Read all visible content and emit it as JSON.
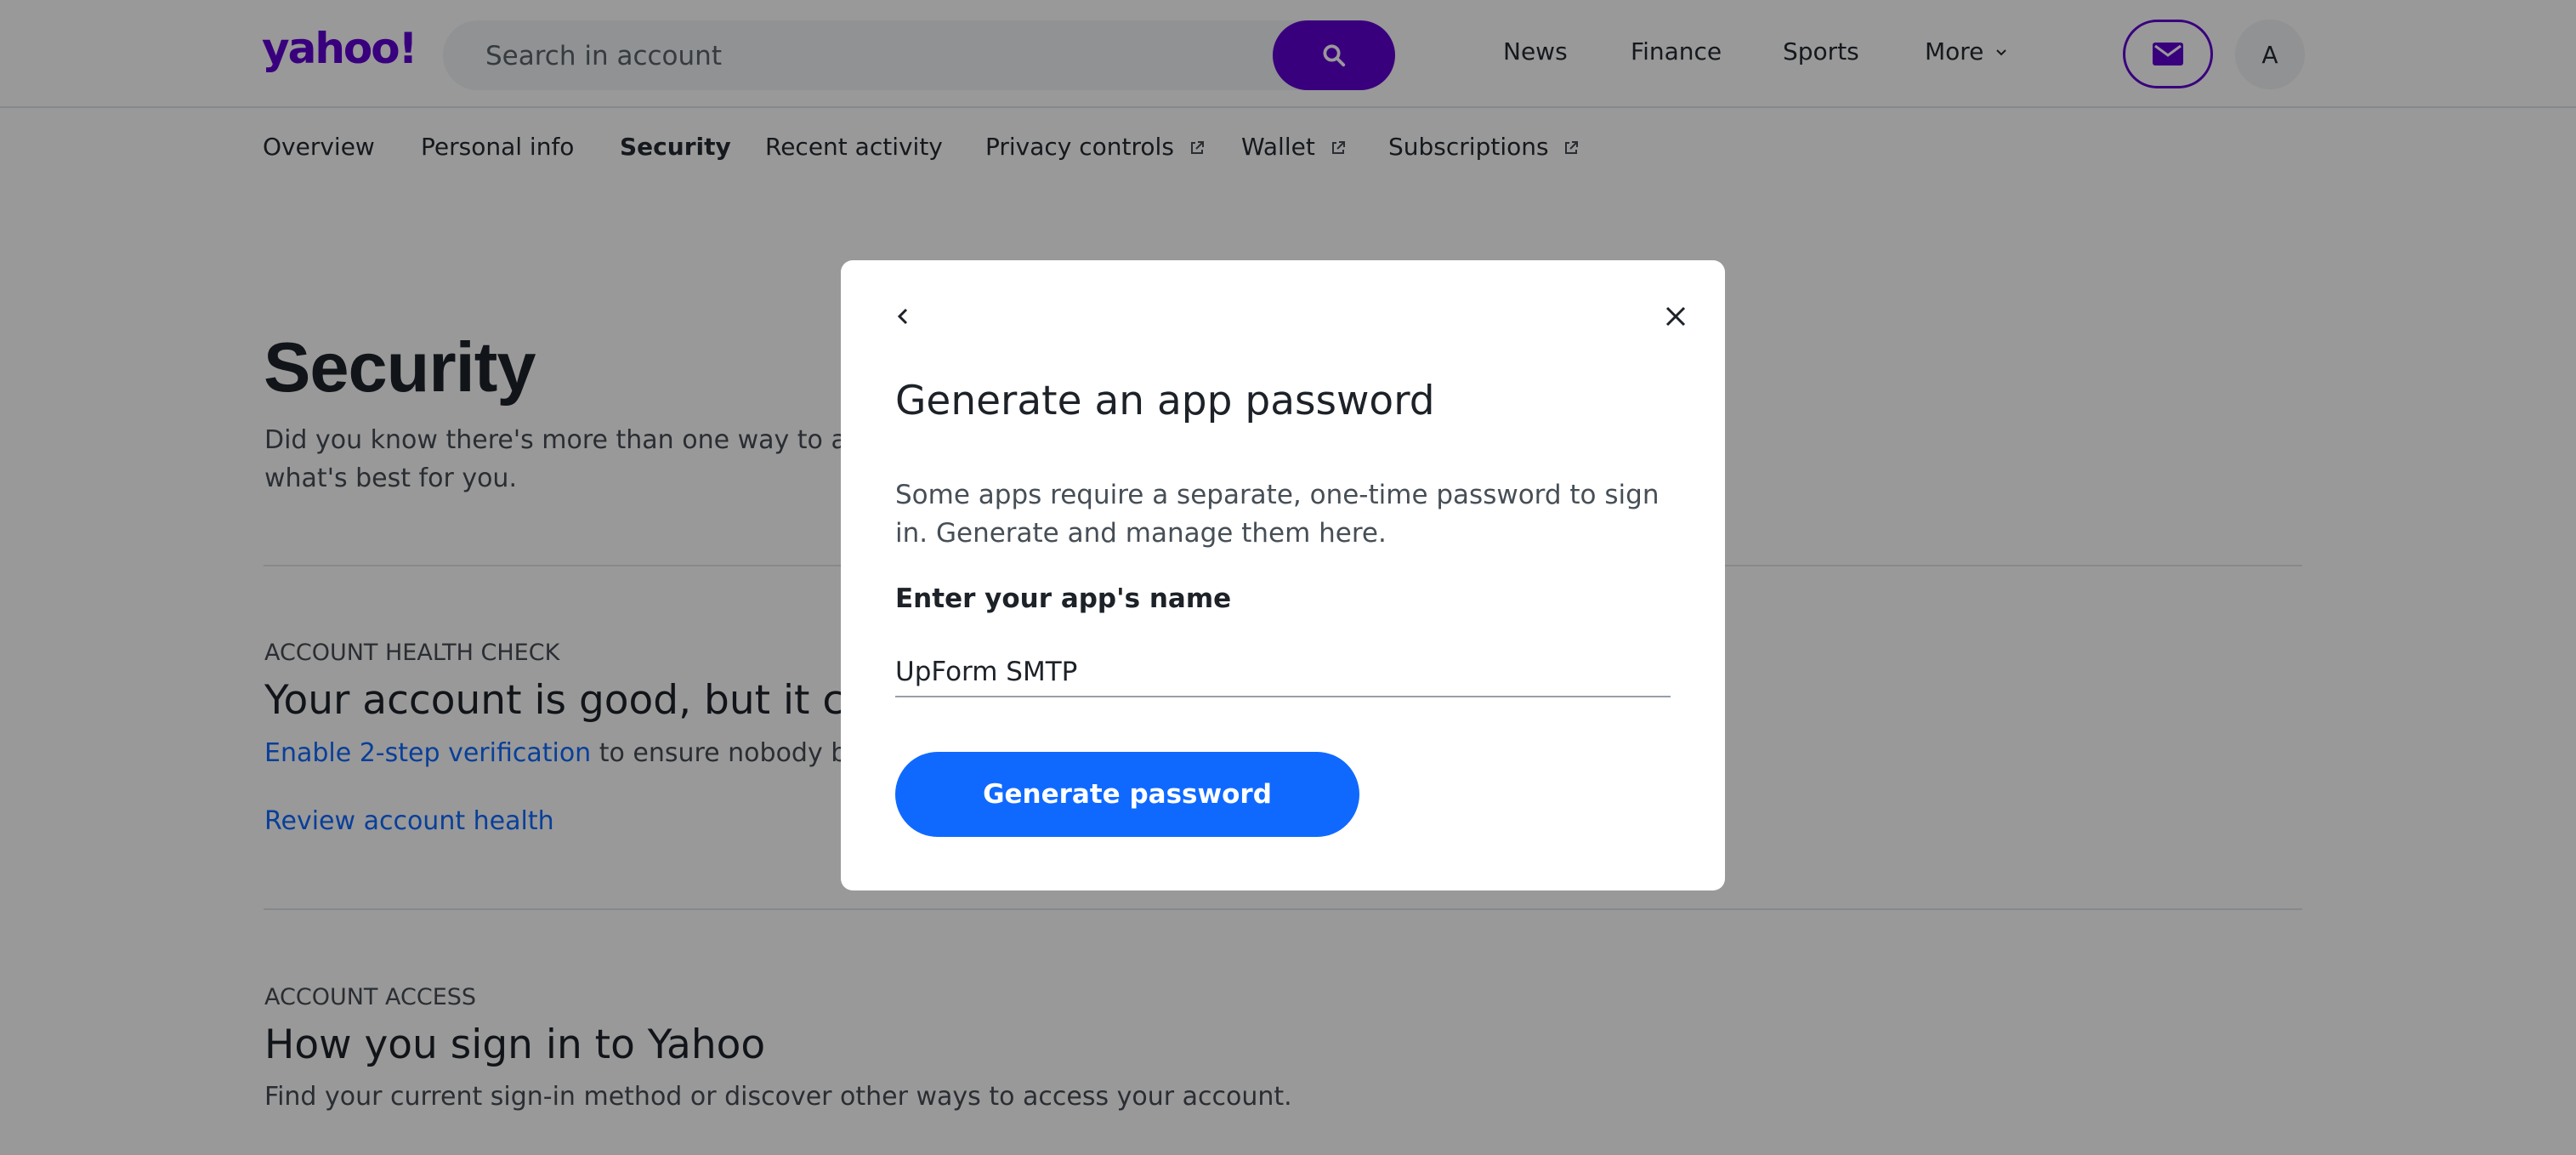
{
  "brand": {
    "logo_text": "yahoo!",
    "accent_color": "#6001d2",
    "primary_button_color": "#0f69ff"
  },
  "header": {
    "search": {
      "placeholder": "Search in account",
      "icon": "search-icon"
    },
    "nav": [
      "News",
      "Finance",
      "Sports",
      "More"
    ],
    "mail_icon": "mail-icon",
    "avatar_initial": "A"
  },
  "subnav": {
    "items": [
      {
        "label": "Overview",
        "external": false
      },
      {
        "label": "Personal info",
        "external": false
      },
      {
        "label": "Security",
        "external": false,
        "active": true
      },
      {
        "label": "Recent activity",
        "external": false
      },
      {
        "label": "Privacy controls",
        "external": true
      },
      {
        "label": "Wallet",
        "external": true
      },
      {
        "label": "Subscriptions",
        "external": true
      }
    ]
  },
  "page": {
    "title": "Security",
    "intro_line1": "Did you know there's more than one way to acc",
    "intro_line2": "what's best for you.",
    "health": {
      "kicker": "ACCOUNT HEALTH CHECK",
      "heading": "Your account is good, but it cou",
      "link": "Enable 2-step verification",
      "rest": " to ensure nobody bu",
      "review_link": "Review account health"
    },
    "access": {
      "kicker": "ACCOUNT ACCESS",
      "heading": "How you sign in to Yahoo",
      "desc": "Find your current sign-in method or discover other ways to access your account."
    }
  },
  "modal": {
    "title": "Generate an app password",
    "description": "Some apps require a separate, one-time password to sign in. Generate and manage them here.",
    "field_label": "Enter your app's name",
    "field_value": "UpForm SMTP",
    "button_label": "Generate password",
    "back_icon": "chevron-left-icon",
    "close_icon": "close-icon"
  }
}
